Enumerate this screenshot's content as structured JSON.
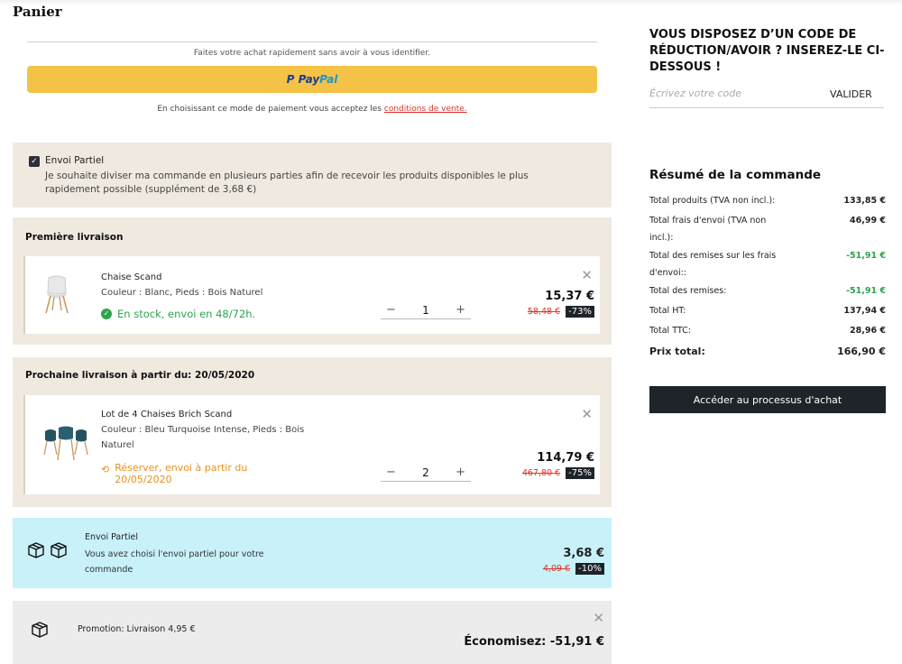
{
  "page": {
    "title": "Panier"
  },
  "paypal": {
    "hint": "Faites votre achat rapidement sans avoir à vous identifier.",
    "button_p": "P",
    "button_pay": "Pay",
    "button_pal": "Pal",
    "terms_text": "En choisissant ce mode de paiement vous acceptez les ",
    "terms_link": "conditions de vente."
  },
  "partial_shipping": {
    "checked": true,
    "title": "Envoi Partiel",
    "description": "Je souhaite diviser ma commande en plusieurs parties afin de recevoir les produits disponibles le plus rapidement possible (supplément de 3,68 €)"
  },
  "deliveries": [
    {
      "title": "Première livraison",
      "item": {
        "name": "Chaise Scand",
        "attributes": "Couleur : Blanc, Pieds : Bois Naturel",
        "availability": "En stock, envoi en 48/72h.",
        "quantity": "1",
        "price": "15,37 €",
        "old_price": "58,48 €",
        "discount": "-73%"
      }
    },
    {
      "title": "Prochaine livraison à partir du: 20/05/2020",
      "item": {
        "name": "Lot de 4 Chaises Brich Scand",
        "attributes": "Couleur : Bleu Turquoise Intense, Pieds : Bois Naturel",
        "availability": "Réserver, envoi à partir du 20/05/2020",
        "quantity": "2",
        "price": "114,79 €",
        "old_price": "467,80 €",
        "discount": "-75%"
      }
    }
  ],
  "partial_fee": {
    "title": "Envoi Partiel",
    "description": "Vous avez choisi l'envoi partiel pour votre commande",
    "price": "3,68 €",
    "old_price": "4,09 €",
    "discount": "-10%"
  },
  "promotion": {
    "label": "Promotion: Livraison 4,95 €",
    "savings": "Économisez: -51,91 €"
  },
  "coupon": {
    "title": "VOUS DISPOSEZ D’UN CODE DE RÉDUCTION/AVOIR ? INSEREZ-LE CI-DESSOUS !",
    "placeholder": "Écrivez votre code",
    "button": "VALIDER"
  },
  "summary": {
    "title": "Résumé de la commande",
    "rows": [
      {
        "label": "Total produits (TVA non incl.):",
        "value": "133,85 €"
      },
      {
        "label": "Total frais d'envoi (TVA non incl.):",
        "value": "46,99 €"
      },
      {
        "label": "Total des remises sur les frais d'envoi::",
        "value": "-51,91 €"
      },
      {
        "label": "Total des remises:",
        "value": "-51,91 €"
      },
      {
        "label": "Total HT:",
        "value": "137,94 €"
      },
      {
        "label": "Total TTC:",
        "value": "28,96 €"
      },
      {
        "label": "Prix total:",
        "value": "166,90 €"
      }
    ],
    "checkout_button": "Accéder au processus d'achat"
  },
  "colors": {
    "accent_dark": "#1f232a",
    "paypal_yellow": "#f5c248",
    "stock_green": "#2ea44f",
    "reserve_orange": "#e8911c",
    "old_price_red": "#d9342b",
    "panel_beige": "#f0e9e0",
    "partial_blue": "#c8f1fa"
  },
  "icons": {
    "checkbox": "checkbox-checked-icon",
    "stock": "check-circle-icon",
    "reserve": "clock-icon",
    "close": "close-icon",
    "box": "package-icon"
  }
}
